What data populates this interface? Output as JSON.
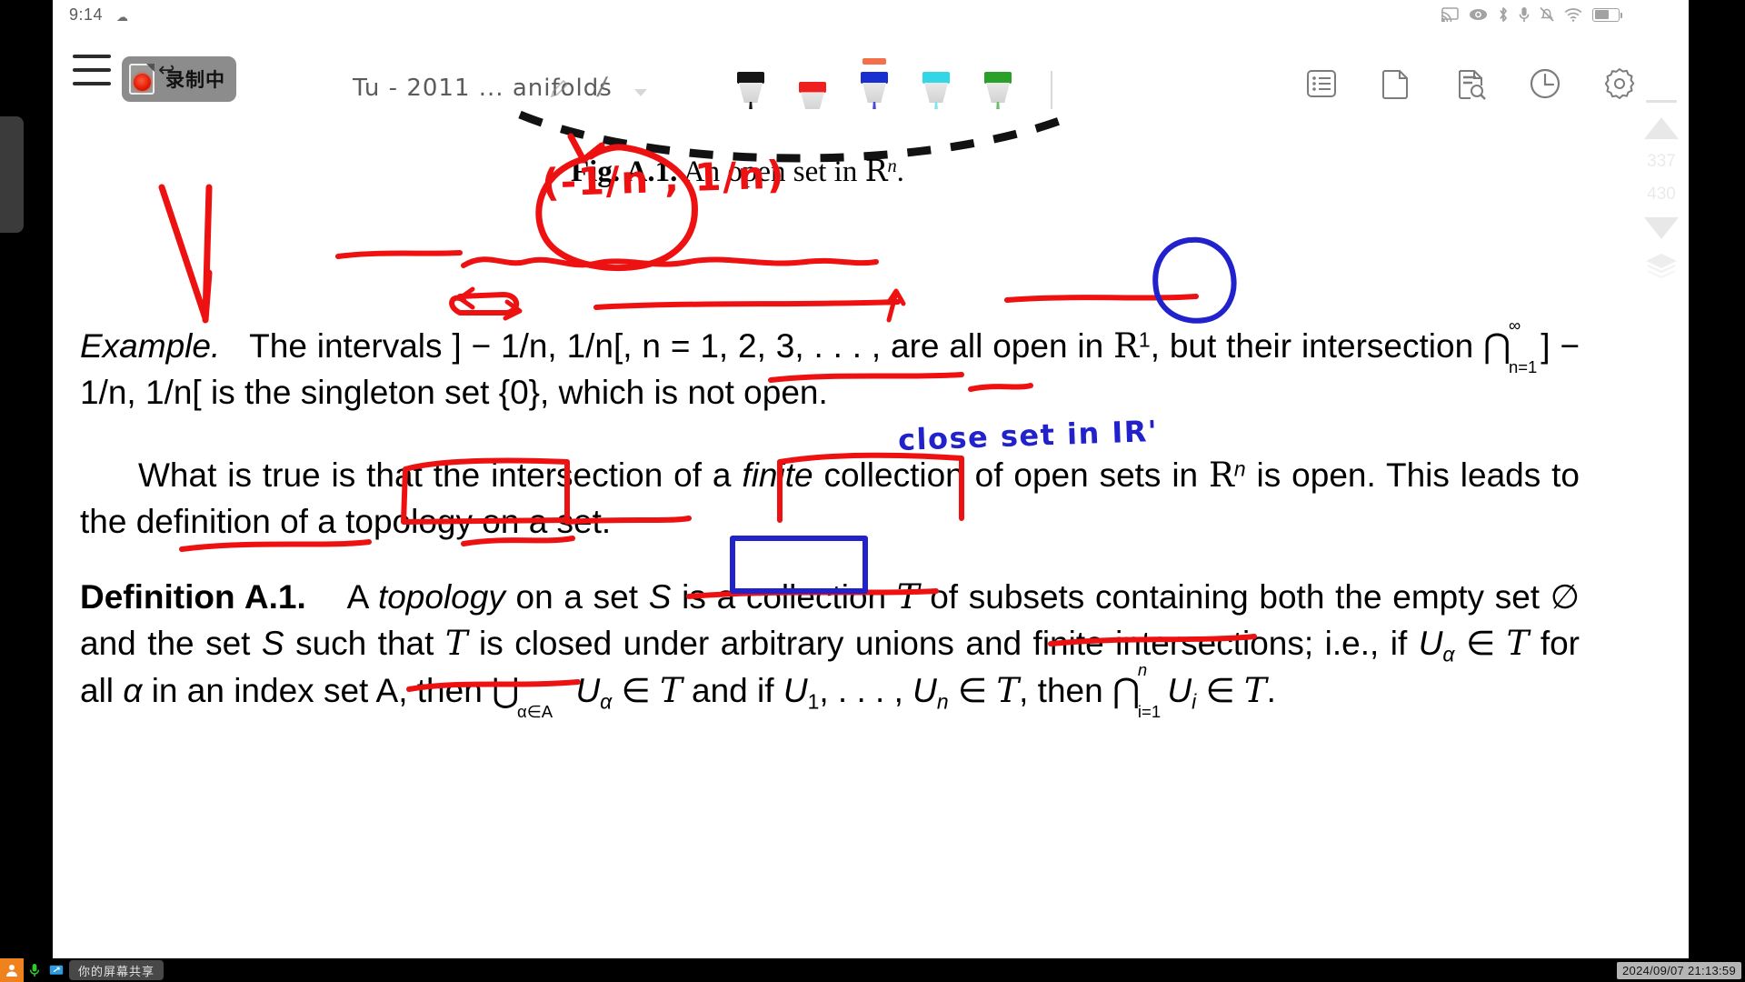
{
  "status_bar": {
    "time": "9:14",
    "time_icon": "cloud-icon",
    "icons": [
      "screen-cast-icon",
      "eye-icon",
      "bluetooth-icon",
      "microphone-icon",
      "bell-muted-icon",
      "wifi-icon",
      "battery-icon"
    ]
  },
  "toolbar": {
    "menu_label": "menu",
    "recording_badge": "录制中",
    "document_title": "Tu - 2011 ... anifolds",
    "title_separator": "/",
    "pens": [
      {
        "name": "pen-black",
        "color": "#151515",
        "size": "37",
        "selected": false
      },
      {
        "name": "pen-red",
        "color": "#ef2020",
        "size": "37",
        "selected": false
      },
      {
        "name": "pen-blue",
        "color": "#1a2fd0",
        "size": "39",
        "selected": true
      },
      {
        "name": "pen-cyan",
        "color": "#33d6e6",
        "size": "38",
        "selected": false
      },
      {
        "name": "pen-green",
        "color": "#2aa02a",
        "size": "43",
        "selected": false
      }
    ],
    "selected_marker_color": "#f2714b",
    "right_icons": [
      "outline-list-icon",
      "page-icon",
      "document-search-icon",
      "history-clock-icon",
      "settings-gear-icon"
    ]
  },
  "page_nav": {
    "up_label": "previous-page",
    "current_page": "337",
    "total_pages": "430",
    "down_label": "next-page",
    "layers_label": "layers"
  },
  "document": {
    "figure_caption_bold": "Fig. A.1.",
    "figure_caption_rest": " An open set in ",
    "figure_caption_math": "R",
    "figure_caption_sup": "n",
    "figure_caption_end": ".",
    "example": {
      "label": "Example.",
      "text_1": "The intervals ] − 1/n, 1/n[, n = 1, 2, 3, . . . , are all open in ",
      "math_r1": "R",
      "sup_1": "1",
      "text_2": ", but their intersection ",
      "bigcap": "⋂",
      "bigcap_bot": "n=1",
      "bigcap_top": "∞",
      "text_3": " ] − 1/n, 1/n[ is the singleton set {0}, which is not open."
    },
    "paragraph_true": {
      "text_1": "What is true is that the intersection of a ",
      "italic_1": "finite",
      "text_2": " collection of open sets in ",
      "math_r": "R",
      "sup": "n",
      "text_3": " is open. This leads to the definition of a topology on a set."
    },
    "definition": {
      "label": "Definition A.1.",
      "text_1": "A ",
      "italic_1": "topology",
      "text_2": " on a set ",
      "italic_2": "S",
      "text_3": " is a collection ",
      "script_t": "T",
      "text_4": " of subsets containing both the empty set ∅ and the set ",
      "italic_3": "S",
      "text_5": " such that ",
      "script_t2": "T",
      "text_6": " is closed under arbitrary unions and finite intersections; i.e., if ",
      "u_alpha": "U",
      "alpha_sub": "α",
      "text_7": " ∈ ",
      "script_t3": "T",
      "text_8": " for all ",
      "alpha": "α",
      "text_9": " in an index set A, then ",
      "bigcup": "⋃",
      "bigcup_sub": "α∈A",
      "u_alpha2": "U",
      "alpha_sub2": "α",
      "text_10": " ∈ ",
      "script_t4": "T",
      "text_11": " and if ",
      "u1": "U",
      "u1_sub": "1",
      "text_12": ", . . . , ",
      "un": "U",
      "un_sub": "n",
      "text_13": " ∈ ",
      "script_t5": "T",
      "text_14": ", then ",
      "bigcap2": "⋂",
      "bigcap2_bot": "i=1",
      "bigcap2_top": "n",
      "ui": "U",
      "ui_sub": "i",
      "text_15": " ∈ ",
      "script_t6": "T",
      "text_16": "."
    }
  },
  "annotations": {
    "ink_red": "#ee1111",
    "ink_blue": "#2222cc",
    "handwriting_interval": "(-1/n , 1/n)",
    "handwriting_close_set": "close set in IR'",
    "circled_fig": "Fig. A.1.",
    "circled_r1": "R1",
    "boxed_topology": "topology",
    "boxed_closed": "closed"
  },
  "bottom_bar": {
    "person_icon": "person-icon",
    "mic_icon": "microphone-icon",
    "share_icon": "screen-share-icon",
    "share_label": "你的屏幕共享",
    "clock": "2024/09/07 21:13:59"
  }
}
